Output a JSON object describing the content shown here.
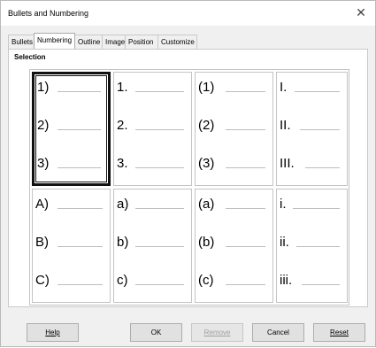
{
  "window": {
    "title": "Bullets and Numbering",
    "close_glyph": "✕"
  },
  "tabs": [
    {
      "label": "Bullets",
      "active": false
    },
    {
      "label": "Numbering",
      "active": true
    },
    {
      "label": "Outline",
      "active": false
    },
    {
      "label": "Image",
      "active": false
    },
    {
      "label": "Position",
      "active": false
    },
    {
      "label": "Customize",
      "active": false
    }
  ],
  "selection": {
    "heading": "Selection",
    "presets": [
      {
        "items": [
          "1)",
          "2)",
          "3)"
        ],
        "selected": true
      },
      {
        "items": [
          "1.",
          "2.",
          "3."
        ],
        "selected": false
      },
      {
        "items": [
          "(1)",
          "(2)",
          "(3)"
        ],
        "selected": false
      },
      {
        "items": [
          "I.",
          "II.",
          "III."
        ],
        "selected": false
      },
      {
        "items": [
          "A)",
          "B)",
          "C)"
        ],
        "selected": false
      },
      {
        "items": [
          "a)",
          "b)",
          "c)"
        ],
        "selected": false
      },
      {
        "items": [
          "(a)",
          "(b)",
          "(c)"
        ],
        "selected": false
      },
      {
        "items": [
          "i.",
          "ii.",
          "iii."
        ],
        "selected": false
      }
    ]
  },
  "buttons": {
    "help": "Help",
    "ok": "OK",
    "remove": "Remove",
    "cancel": "Cancel",
    "reset": "Reset"
  }
}
